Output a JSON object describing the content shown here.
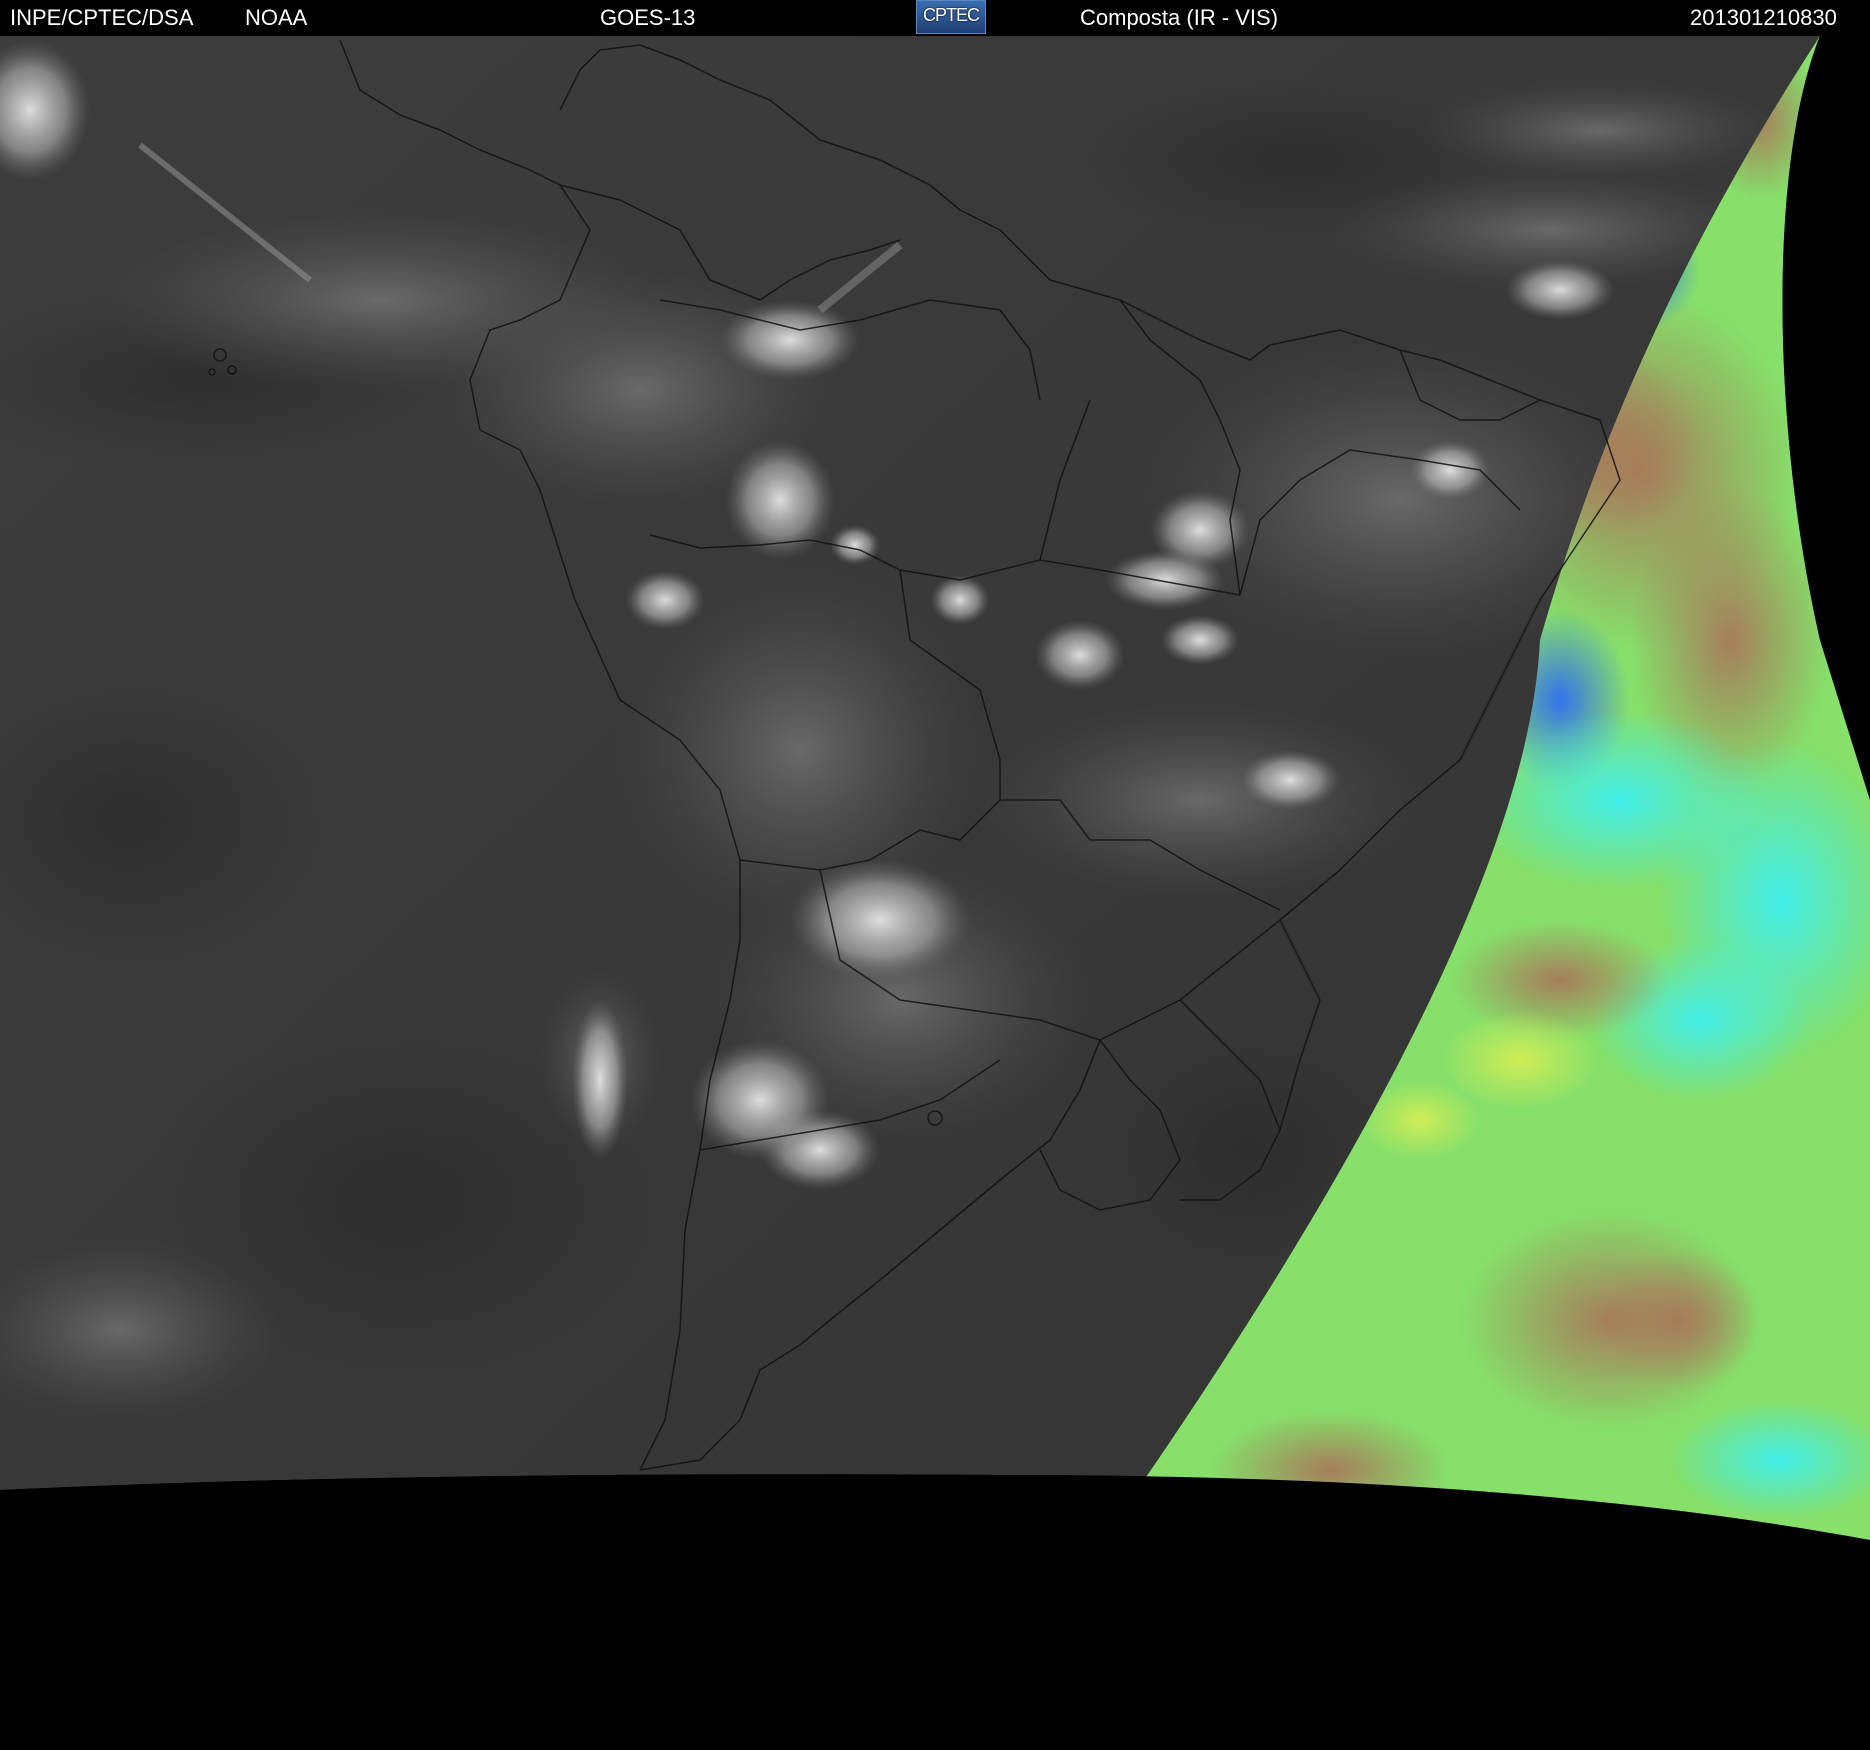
{
  "header": {
    "org": "INPE/CPTEC/DSA",
    "agency": "NOAA",
    "satellite": "GOES-13",
    "logo_text": "CPTEC",
    "product": "Composta (IR - VIS)",
    "timestamp": "201301210830"
  },
  "colors": {
    "background": "#000000",
    "ir_gray": "#3a3a3a",
    "cloud_white": "#d8d8d8",
    "vis_green": "#8ce66a",
    "vis_cyan": "#44e8e8",
    "vis_brown": "#a07a5a",
    "vis_blue": "#3a7af0",
    "boundary_line": "#111111"
  }
}
